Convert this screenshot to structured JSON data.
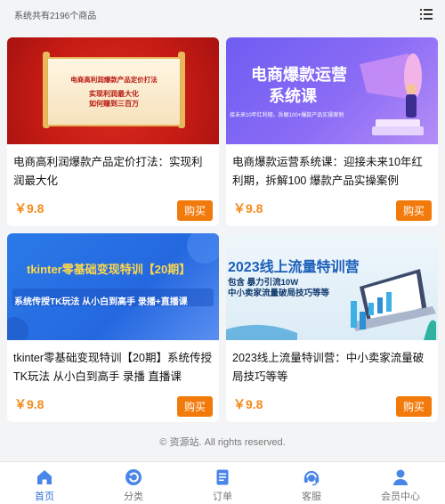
{
  "header": {
    "product_count_text": "系统共有2196个商品",
    "list_toggle_icon": "list-view-icon"
  },
  "products": [
    {
      "title": "电商高利润爆款产品定价打法：实现利润最大化",
      "price": "￥9.8",
      "buy_label": "购买",
      "thumb": {
        "line1": "电商高利润爆款产品定价打法",
        "line2": "实现利润最大化",
        "line3": "如何赚到三百万"
      }
    },
    {
      "title": "电商爆款运营系统课：迎接未来10年红利期，拆解100 爆款产品实操案例",
      "price": "￥9.8",
      "buy_label": "购买",
      "thumb": {
        "line1": "电商爆款运营",
        "line2": "系统课",
        "line3": "接未来10年红利期，拆解100+爆款产品实操案例"
      }
    },
    {
      "title": "tkinter零基础变现特训【20期】系统传授TK玩法 从小白到高手 录播 直播课",
      "price": "￥9.8",
      "buy_label": "购买",
      "thumb": {
        "line1": "tkinter零基础变现特训【20期】",
        "line2": "系统传授TK玩法 从小白到高手 录播+直播课"
      }
    },
    {
      "title": "2023线上流量特训营：中小卖家流量破局技巧等等",
      "price": "￥9.8",
      "buy_label": "购买",
      "thumb": {
        "line1": "2023线上流量特训营",
        "line2": "包含 暴力引流10W",
        "line3": "中小卖家流量破局技巧等等"
      }
    }
  ],
  "footer": {
    "copyright": "© 资源站. All rights reserved."
  },
  "tabbar": {
    "active_color": "#2f6fd8",
    "items": [
      {
        "label": "首页",
        "icon": "home-icon"
      },
      {
        "label": "分类",
        "icon": "category-icon"
      },
      {
        "label": "订单",
        "icon": "order-icon"
      },
      {
        "label": "客服",
        "icon": "customer-service-icon"
      },
      {
        "label": "会员中心",
        "icon": "member-icon"
      }
    ]
  }
}
